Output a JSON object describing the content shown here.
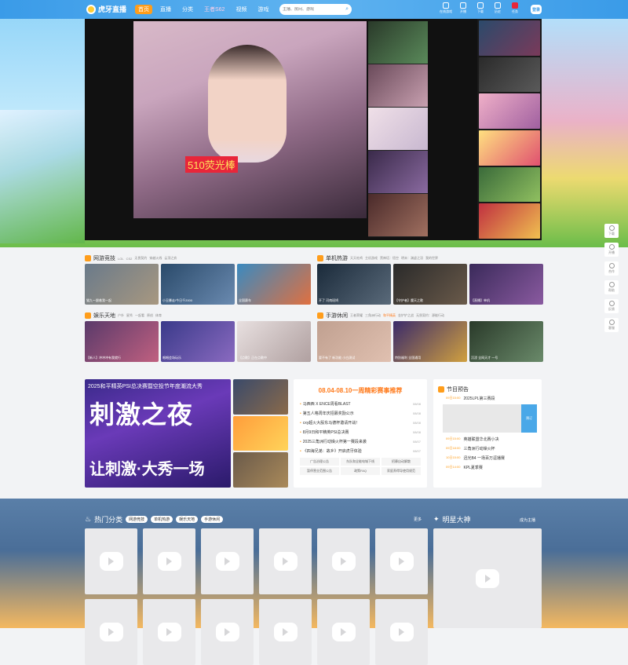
{
  "header": {
    "logo_text": "虎牙直播",
    "nav": [
      "首页",
      "直播",
      "分类",
      "王者S62",
      "视频",
      "游戏"
    ],
    "search_placeholder": "主播、房间、游戏",
    "icons": [
      {
        "label": "开播",
        "icon": "broadcast-icon"
      },
      {
        "label": "下载",
        "icon": "download-icon"
      },
      {
        "label": "历史",
        "icon": "history-icon"
      },
      {
        "label": "任务",
        "icon": "task-icon"
      }
    ],
    "game_center_label": "在线游戏",
    "login_label": "登录"
  },
  "player": {
    "gift_text": "510荧光棒"
  },
  "right_rail": [
    "下载",
    "开播",
    "合作",
    "帮助",
    "反馈",
    "客服"
  ],
  "sections": [
    {
      "title": "网游竞技",
      "tags": [
        "LOL",
        "CS2",
        "无畏契约",
        "穿越火线",
        "云顶之弈"
      ],
      "cards": [
        "猫九～跟着我一起",
        "小丑暴走!今日千2000",
        "全国赛车"
      ]
    },
    {
      "title": "单机热游",
      "tags": [
        "天天吃鸡",
        "主机游戏",
        "黑神话：悟空",
        "明末：渊虚之羽",
        "我的世界"
      ],
      "cards": [
        "开了 河南斑鸠",
        "【守护者】魔天之歌",
        "【直播】单机"
      ]
    },
    {
      "title": "娱乐天地",
      "tags": [
        "户外",
        "星秀",
        "一起看",
        "原创",
        "体育"
      ],
      "cards": [
        "【新人】冲冲冲有我就行",
        "唱唱会场玩乐",
        "【点歌】正在点歌中"
      ]
    },
    {
      "title": "手游休闲",
      "tags": [
        "王者荣耀",
        "三角洲行动",
        "和平精英",
        "金铲铲之战",
        "无畏契约：源能行动"
      ],
      "cards": [
        "要不有了 新功能 小白测试",
        "特别福利 全国通用",
        "沉浸 全网天才 一号"
      ]
    }
  ],
  "banner": {
    "subtitle": "2025和平精英PSI总决赛暨空投节年度潮流大秀",
    "headline": "刺激之夜",
    "tagline": "让刺激·大秀一场"
  },
  "news": {
    "title": "08.04-08.10一周精彩赛事推荐",
    "items": [
      {
        "text": "马西西 X ENCE周看BLAST",
        "date": "08/08"
      },
      {
        "text": "第五人格周年庆招募奖励公示",
        "date": "08/08"
      },
      {
        "text": "cxy超火大股东马德杯邀请开战！",
        "date": "08/08"
      },
      {
        "text": "8月9日和平精英PSI总决赛",
        "date": "08/08"
      },
      {
        "text": "2025三角洲行动燥火杯第一赛段来袭",
        "date": "08/07"
      },
      {
        "text": "《四海兄弟：故乡》开启虎牙体验",
        "date": "08/07"
      }
    ],
    "links": [
      "广告治理公告",
      "东队和全能电城下线",
      "招募自动解散",
      "暂停营业范围公告",
      "政策FAQ",
      "家庭养得导使用规范"
    ]
  },
  "schedule": {
    "title": "节目预告",
    "items_top": [
      {
        "time": "09日15:00",
        "name": "2025LPL第三赛段"
      }
    ],
    "player_label": "预订",
    "items": [
      {
        "time": "09日15:00",
        "name": "英雄联盟华北赛小决"
      },
      {
        "time": "09日18:00",
        "name": "三角洲行动燥火杯"
      },
      {
        "time": "10日15:00",
        "name": "迅光B4 一场百万逗播赛"
      },
      {
        "time": "09日14:00",
        "name": "KPL夏季赛"
      }
    ]
  },
  "hot": {
    "title": "热门分类",
    "chips": [
      "网游竞技",
      "单机热游",
      "娱乐天地",
      "手游休闲"
    ],
    "more": "更多",
    "star_title": "明星大神",
    "star_more": "成为主播"
  }
}
